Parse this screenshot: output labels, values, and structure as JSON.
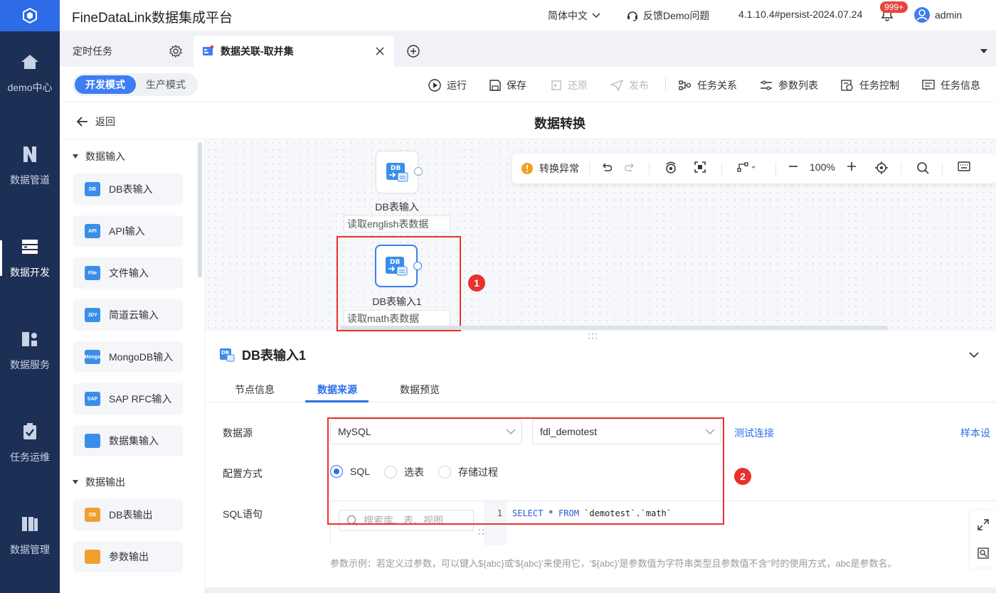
{
  "app": {
    "title": "FineDataLink数据集成平台",
    "language": "简体中文",
    "feedback": "反馈Demo问题",
    "version": "4.1.10.4#persist-2024.07.24",
    "notification_count": "999+",
    "user": "admin"
  },
  "nav": {
    "items": [
      {
        "label": "demo中心",
        "icon": "home-icon"
      },
      {
        "label": "数据管道",
        "icon": "pipeline-icon"
      },
      {
        "label": "数据开发",
        "icon": "dev-icon"
      },
      {
        "label": "数据服务",
        "icon": "service-icon"
      },
      {
        "label": "任务运维",
        "icon": "ops-icon"
      },
      {
        "label": "数据管理",
        "icon": "manage-icon"
      }
    ],
    "active": "数据开发"
  },
  "tabs": [
    {
      "label": "定时任务"
    },
    {
      "label": "数据关联-取并集"
    }
  ],
  "toolbar": {
    "mode_dev": "开发模式",
    "mode_prod": "生产模式",
    "run": "运行",
    "save": "保存",
    "restore": "还原",
    "publish": "发布",
    "relations": "任务关系",
    "params": "参数列表",
    "control": "任务控制",
    "info": "任务信息"
  },
  "subheader": {
    "back": "返回",
    "title": "数据转换"
  },
  "components": {
    "input_group": "数据输入",
    "inputs": [
      {
        "label": "DB表输入",
        "tag": "DB",
        "color": "#3b8ee8"
      },
      {
        "label": "API输入",
        "tag": "API",
        "color": "#3b8ee8"
      },
      {
        "label": "文件输入",
        "tag": "File",
        "color": "#3b8ee8"
      },
      {
        "label": "简道云输入",
        "tag": "JDY",
        "color": "#3b8ee8"
      },
      {
        "label": "MongoDB输入",
        "tag": "Mongo",
        "color": "#3b8ee8"
      },
      {
        "label": "SAP RFC输入",
        "tag": "SAP",
        "color": "#3b8ee8"
      },
      {
        "label": "数据集输入",
        "tag": "",
        "color": "#3b8ee8"
      }
    ],
    "output_group": "数据输出",
    "outputs": [
      {
        "label": "DB表输出",
        "tag": "DB",
        "color": "#f0a030"
      },
      {
        "label": "参数输出",
        "tag": "",
        "color": "#f0a030"
      }
    ]
  },
  "canvas": {
    "status": "转换异常",
    "zoom": "100%",
    "nodes": [
      {
        "label": "DB表输入",
        "desc": "读取english表数据"
      },
      {
        "label": "DB表输入1",
        "desc": "读取math表数据"
      }
    ],
    "annotation_1": "1"
  },
  "detail": {
    "title": "DB表输入1",
    "tabs": [
      "节点信息",
      "数据来源",
      "数据预览"
    ],
    "active_tab": "数据来源",
    "datasource_label": "数据源",
    "datasource_type": "MySQL",
    "datasource_conn": "fdl_demotest",
    "test_conn": "测试连接",
    "sample": "样本设",
    "config_label": "配置方式",
    "config_options": [
      "SQL",
      "选表",
      "存储过程"
    ],
    "config_selected": "SQL",
    "sql_label": "SQL语句",
    "search_placeholder": "搜索库、表、视图",
    "line_no": "1",
    "sql_kw1": "SELECT",
    "sql_mid": " * ",
    "sql_kw2": "FROM",
    "sql_rest": " `demotest`.`math`",
    "hint": "参数示例：若定义过参数，可以键入${abc}或'${abc}'来使用它，'${abc}'是参数值为字符串类型且参数值不含''时的使用方式，abc是参数名。",
    "annotation_2": "2"
  }
}
